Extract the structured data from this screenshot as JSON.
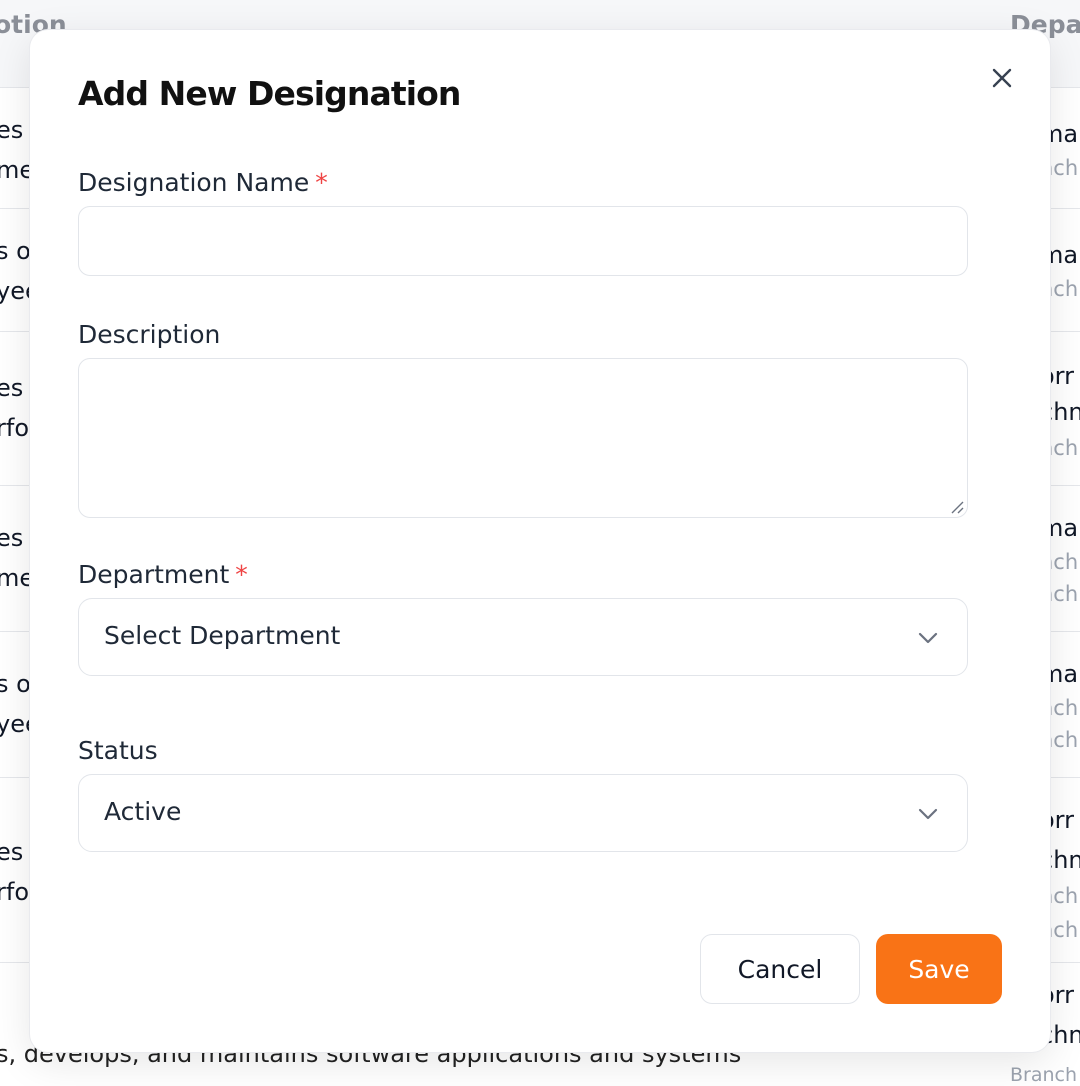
{
  "background_table": {
    "headers": {
      "description": "otion",
      "department": "Depa"
    },
    "rows": [
      {
        "left": [
          "es",
          "mer"
        ],
        "right": [
          "ma",
          "nch"
        ]
      },
      {
        "left": [
          "s o",
          "yee"
        ],
        "right": [
          "ma",
          "nch"
        ]
      },
      {
        "left": [
          "es",
          "rfo"
        ],
        "right": [
          "orr",
          "chn",
          "nch"
        ]
      },
      {
        "left": [
          "es",
          "mer"
        ],
        "right": [
          "ma",
          "nch",
          "nch"
        ]
      },
      {
        "left": [
          "s o",
          "yee"
        ],
        "right": [
          "ma",
          "nch",
          "nch"
        ]
      },
      {
        "left": [
          "es",
          "rfo"
        ],
        "right": [
          "orr",
          "chn",
          "nch",
          "nch"
        ]
      },
      {
        "left": [],
        "right": [
          "orr",
          "chn"
        ]
      }
    ],
    "bottom_text": "s, develops, and maintains software applications and systems",
    "bottom_right": "Branch"
  },
  "modal": {
    "title": "Add New Designation",
    "close_icon": "close-icon",
    "fields": {
      "designation_name": {
        "label": "Designation Name",
        "required_mark": "*",
        "value": ""
      },
      "description": {
        "label": "Description",
        "value": ""
      },
      "department": {
        "label": "Department",
        "required_mark": "*",
        "selected": "Select Department"
      },
      "status": {
        "label": "Status",
        "selected": "Active"
      }
    },
    "buttons": {
      "cancel": "Cancel",
      "save": "Save"
    }
  },
  "colors": {
    "accent": "#f97316",
    "required": "#ef4444"
  }
}
